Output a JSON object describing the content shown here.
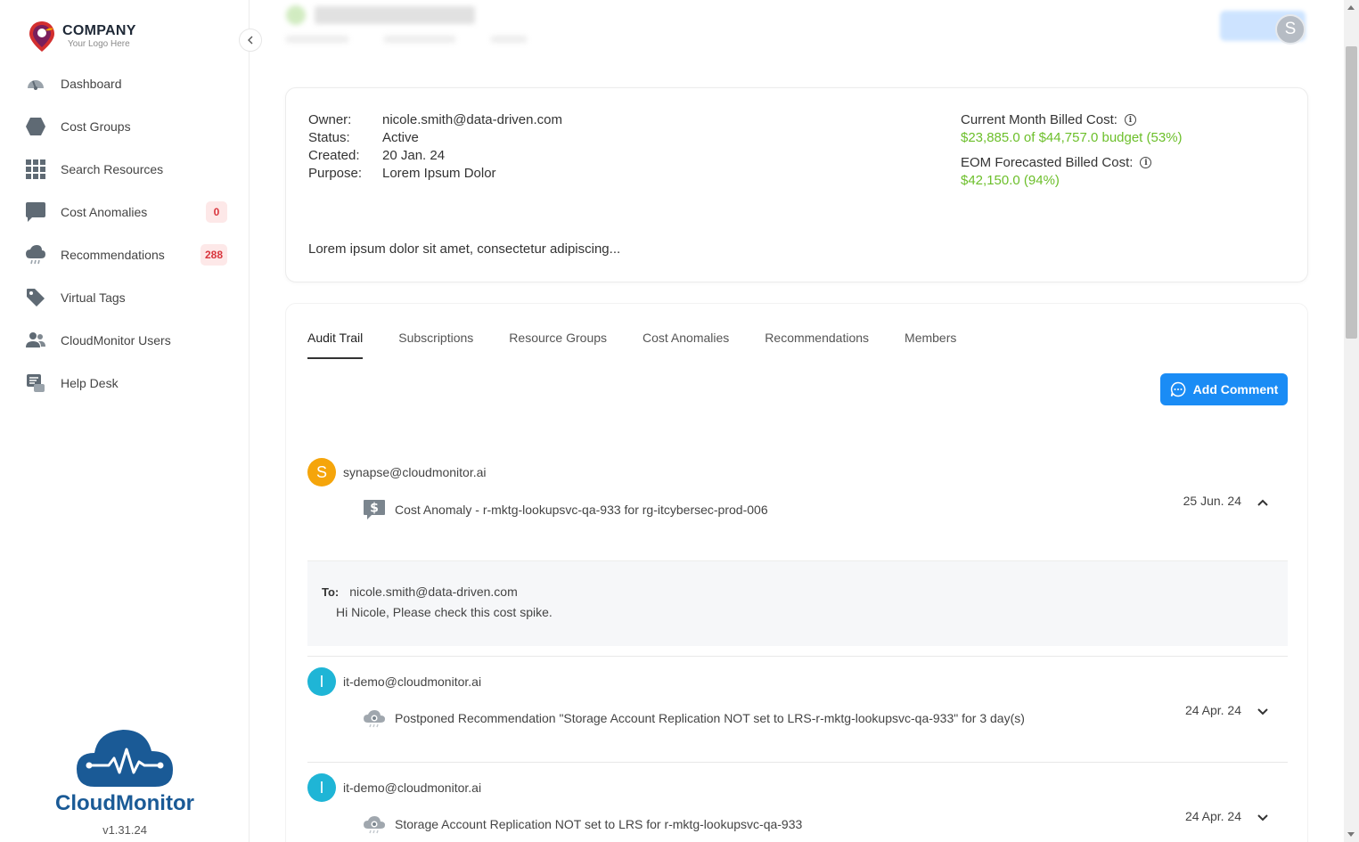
{
  "logo": {
    "name": "COMPANY",
    "tagline": "Your Logo Here"
  },
  "sidebar": {
    "items": [
      {
        "label": "Dashboard",
        "icon": "dashboard-gauge-icon"
      },
      {
        "label": "Cost Groups",
        "icon": "hexagon-icon"
      },
      {
        "label": "Search Resources",
        "icon": "grid-icon"
      },
      {
        "label": "Cost Anomalies",
        "icon": "chat-bubble-icon",
        "badge": "0"
      },
      {
        "label": "Recommendations",
        "icon": "cloud-rain-icon",
        "badge": "288"
      },
      {
        "label": "Virtual Tags",
        "icon": "tag-icon"
      },
      {
        "label": "CloudMonitor Users",
        "icon": "users-icon"
      },
      {
        "label": "Help Desk",
        "icon": "help-desk-icon"
      }
    ]
  },
  "brand": {
    "name": "CloudMonitor",
    "version": "v1.31.24"
  },
  "header": {
    "user_initial": "S"
  },
  "info": {
    "owner_label": "Owner:",
    "owner": "nicole.smith@data-driven.com",
    "status_label": "Status:",
    "status": "Active",
    "created_label": "Created:",
    "created": "20 Jan. 24",
    "purpose_label": "Purpose:",
    "purpose": "Lorem Ipsum Dolor",
    "description": "Lorem ipsum dolor sit amet, consectetur adipiscing...",
    "current_cost_label": "Current Month Billed Cost:",
    "current_cost_value": "$23,885.0 of $44,757.0 budget (53%)",
    "forecast_label": "EOM Forecasted Billed Cost:",
    "forecast_value": "$42,150.0 (94%)"
  },
  "tabs": [
    "Audit Trail",
    "Subscriptions",
    "Resource Groups",
    "Cost Anomalies",
    "Recommendations",
    "Members"
  ],
  "add_comment": "Add Comment",
  "entries": [
    {
      "initial": "S",
      "email": "synapse@cloudmonitor.ai",
      "text": "Cost Anomaly - r-mktg-lookupsvc-qa-933 for rg-itcybersec-prod-006",
      "date": "25 Jun. 24",
      "avatar_color": "#f5a50b"
    },
    {
      "initial": "I",
      "email": "it-demo@cloudmonitor.ai",
      "text": "Postponed Recommendation \"Storage Account Replication NOT set to LRS-r-mktg-lookupsvc-qa-933\" for 3 day(s)",
      "date": "24 Apr. 24",
      "avatar_color": "#1fb5d6"
    },
    {
      "initial": "I",
      "email": "it-demo@cloudmonitor.ai",
      "text": "Storage Account Replication NOT set to LRS for r-mktg-lookupsvc-qa-933",
      "date": "24 Apr. 24",
      "avatar_color": "#1fb5d6"
    }
  ],
  "message": {
    "to_label": "To:",
    "to": "nicole.smith@data-driven.com",
    "body": "Hi Nicole, Please check this cost spike."
  },
  "colors": {
    "accent": "#1a8cf5",
    "success": "#6cbf2a",
    "badge_text": "#d9363e",
    "brand": "#1a5a96"
  }
}
